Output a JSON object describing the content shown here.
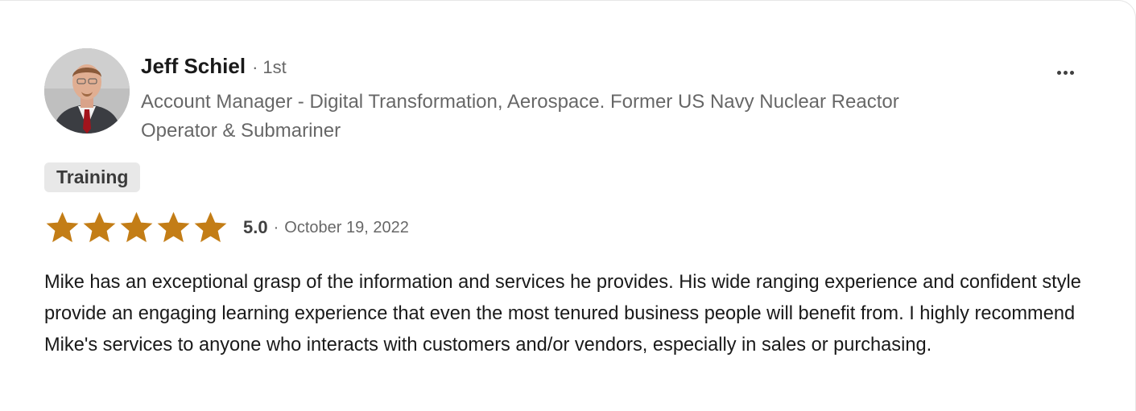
{
  "reviewer": {
    "name": "Jeff Schiel",
    "separator": "·",
    "degree": "1st",
    "headline": "Account Manager - Digital Transformation, Aerospace. Former US Navy Nuclear Reactor Operator & Submariner"
  },
  "service_tag": "Training",
  "rating": {
    "stars": 5,
    "max_stars": 5,
    "score": "5.0",
    "separator": "·",
    "date": "October 19, 2022",
    "star_color": "#c37d16"
  },
  "review_text": "Mike has an exceptional grasp of the information and services he provides. His wide ranging experience and confident style provide an engaging learning experience that even the most tenured business people will benefit from. I highly recommend Mike's services to anyone who interacts with customers and/or vendors, especially in sales or purchasing.",
  "more_menu": {
    "icon": "more-horizontal-icon"
  }
}
